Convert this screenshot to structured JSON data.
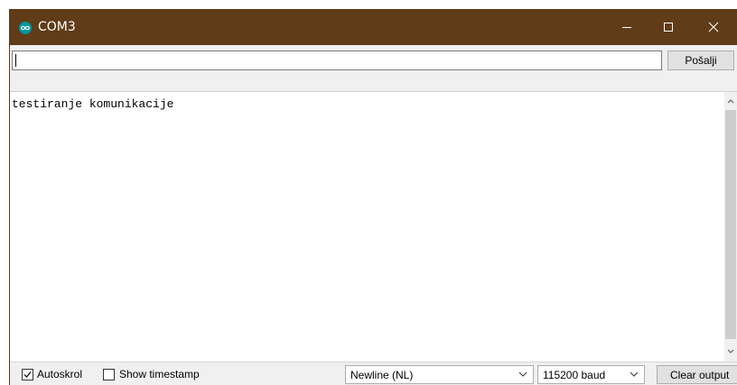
{
  "window": {
    "title": "COM3",
    "icon": "arduino-infinity-icon",
    "titlebar_color": "#603c18"
  },
  "send": {
    "input_value": "",
    "button_label": "Pošalji"
  },
  "output": {
    "text": "testiranje komunikacije"
  },
  "status": {
    "autoscroll_label": "Autoskrol",
    "autoscroll_checked": true,
    "timestamp_label": "Show timestamp",
    "timestamp_checked": false,
    "line_ending": "Newline (NL)",
    "baud_rate": "115200 baud",
    "clear_label": "Clear output"
  }
}
